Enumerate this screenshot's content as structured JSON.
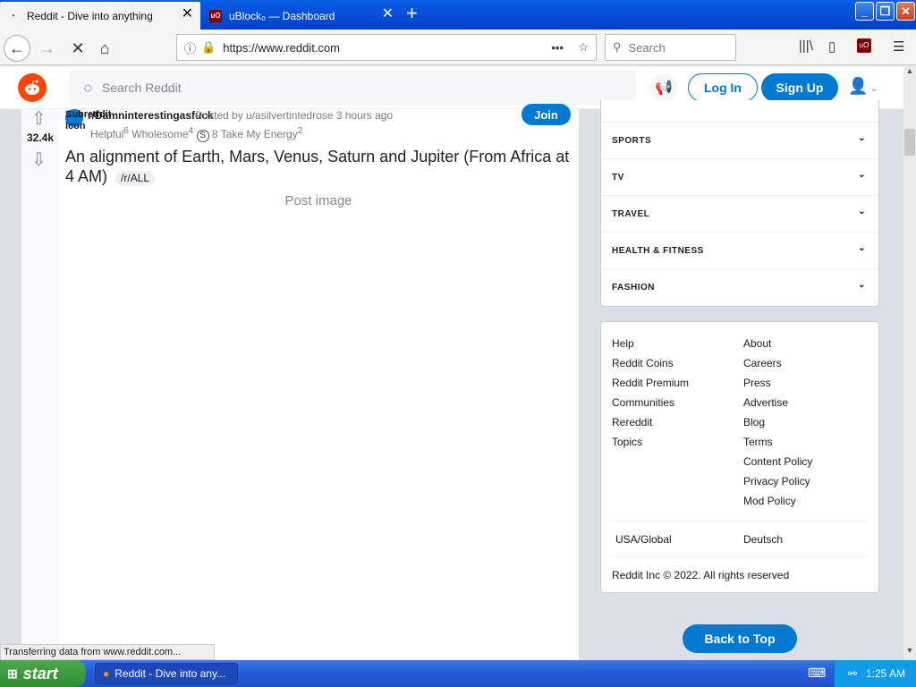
{
  "browser": {
    "tabs": [
      {
        "title": "Reddit - Dive into anything",
        "active": true
      },
      {
        "title": "uBlock₀ — Dashboard",
        "active": false
      }
    ],
    "url": "https://www.reddit.com",
    "search_placeholder": "Search",
    "status_text": "Transferring data from www.reddit.com..."
  },
  "reddit": {
    "search_placeholder": "Search Reddit",
    "login_label": "Log In",
    "signup_label": "Sign Up",
    "post": {
      "votes": "32.4k",
      "subreddit_icon_alt": "Subreddit Icon",
      "subreddit": "r/Damninterestingasfuck",
      "posted_by": "· Posted by u/asilvertintedrose 3 hours ago",
      "join_label": "Join",
      "awards": [
        {
          "name": "Helpful",
          "count": "6"
        },
        {
          "name": "Wholesome",
          "count": "4"
        },
        {
          "name": "",
          "count": "8"
        },
        {
          "name": "Take My Energy",
          "count": "2"
        }
      ],
      "title": "An alignment of Earth, Mars, Venus, Saturn and Jupiter (From Africa at 4 AM)",
      "flair": "/r/ALL",
      "image_alt": "Post image"
    },
    "topics": [
      "SPORTS",
      "TV",
      "TRAVEL",
      "HEALTH & FITNESS",
      "FASHION"
    ],
    "footer": {
      "col1": [
        "Help",
        "Reddit Coins",
        "Reddit Premium",
        "Communities",
        "Rereddit",
        "Topics"
      ],
      "col2": [
        "About",
        "Careers",
        "Press",
        "Advertise",
        "Blog",
        "Terms",
        "Content Policy",
        "Privacy Policy",
        "Mod Policy"
      ],
      "lang1": "USA/Global",
      "lang2": "Deutsch",
      "copyright": "Reddit Inc © 2022. All rights reserved"
    },
    "back_to_top": "Back to Top"
  },
  "taskbar": {
    "start_label": "start",
    "window_label": "Reddit - Dive into any...",
    "clock": "1:25 AM"
  },
  "colors": {
    "reddit_orange": "#ff4500",
    "reddit_blue": "#0079d3",
    "xp_blue": "#245edb"
  }
}
